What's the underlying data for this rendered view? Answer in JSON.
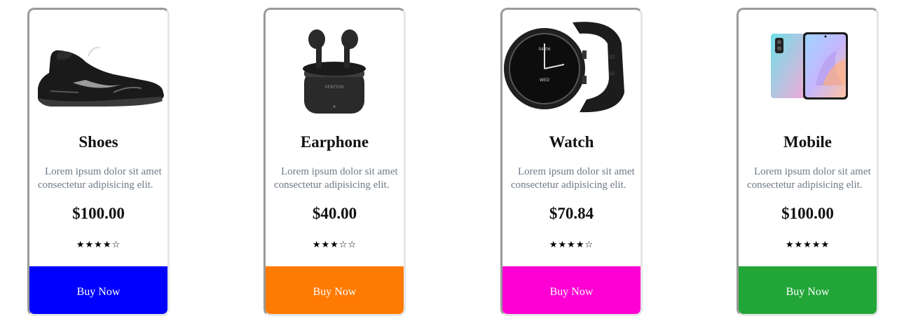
{
  "products": [
    {
      "title": "Shoes",
      "description": "Lorem ipsum dolor sit amet consectetur adipisicing elit.",
      "price": "$100.00",
      "rating": 4,
      "stars": "★★★★☆",
      "button_label": "Buy Now",
      "button_color": "#0000ff",
      "image": "black-sneaker"
    },
    {
      "title": "Earphone",
      "description": "Lorem ipsum dolor sit amet consectetur adipisicing elit.",
      "price": "$40.00",
      "rating": 3,
      "stars": "★★★☆☆",
      "button_label": "Buy Now",
      "button_color": "#ff7a00",
      "image": "wireless-earbuds-case",
      "image_brand_text": "VENTION"
    },
    {
      "title": "Watch",
      "description": "Lorem ipsum dolor sit amet consectetur adipisicing elit.",
      "price": "$70.84",
      "rating": 4,
      "stars": "★★★★☆",
      "button_label": "Buy Now",
      "button_color": "#ff00d4",
      "image": "smart-watch",
      "image_screen_text": [
        "04/06",
        "WED"
      ]
    },
    {
      "title": "Mobile",
      "description": "Lorem ipsum dolor sit amet consectetur adipisicing elit.",
      "price": "$100.00",
      "rating": 5,
      "stars": "★★★★★",
      "button_label": "Buy Now",
      "button_color": "#22a638",
      "image": "smartphone"
    }
  ]
}
